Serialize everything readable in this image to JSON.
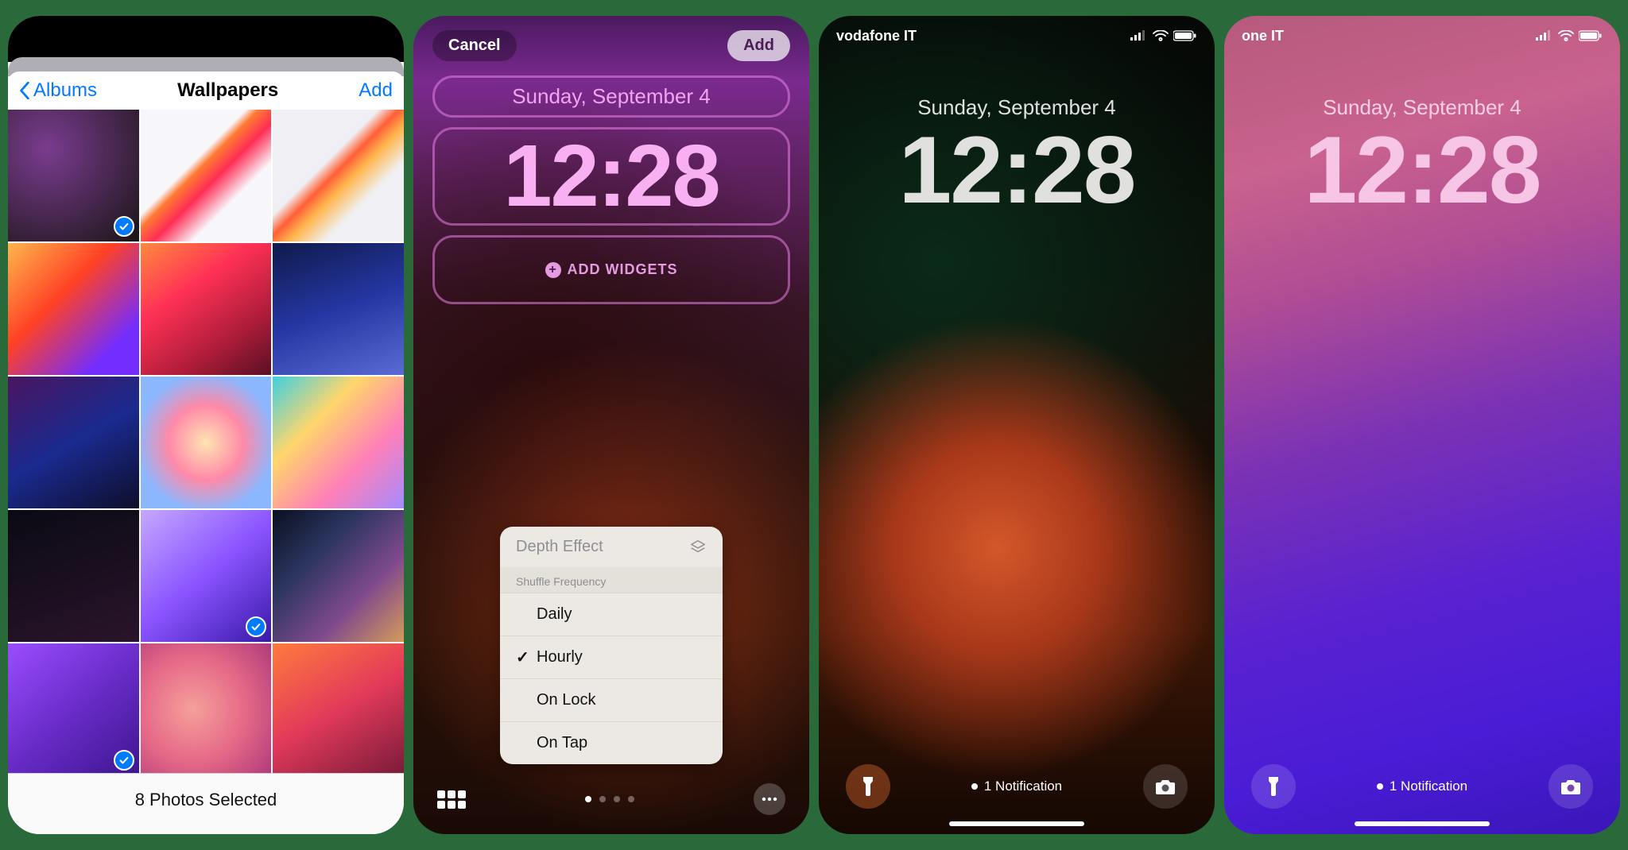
{
  "picker": {
    "back_label": "Albums",
    "title": "Wallpapers",
    "add_label": "Add",
    "selected_footer": "8 Photos Selected",
    "thumbs": [
      {
        "g": "g1",
        "checked": true
      },
      {
        "g": "g2",
        "checked": false
      },
      {
        "g": "g3",
        "checked": false
      },
      {
        "g": "g4",
        "checked": false
      },
      {
        "g": "g5",
        "checked": false
      },
      {
        "g": "g6",
        "checked": false
      },
      {
        "g": "g7",
        "checked": false
      },
      {
        "g": "g8",
        "checked": false
      },
      {
        "g": "g9",
        "checked": false
      },
      {
        "g": "g10",
        "checked": false
      },
      {
        "g": "g11",
        "checked": true
      },
      {
        "g": "g12",
        "checked": false
      },
      {
        "g": "g13",
        "checked": true
      },
      {
        "g": "g14",
        "checked": false
      },
      {
        "g": "g15",
        "checked": false
      }
    ]
  },
  "editor": {
    "cancel": "Cancel",
    "add": "Add",
    "date": "Sunday, September 4",
    "time": "12:28",
    "add_widgets": "ADD WIDGETS",
    "menu": {
      "depth": "Depth Effect",
      "header": "Shuffle Frequency",
      "options": [
        "Daily",
        "Hourly",
        "On Lock",
        "On Tap"
      ],
      "selected": "Hourly"
    }
  },
  "lock3": {
    "carrier": "vodafone IT",
    "date": "Sunday, September 4",
    "time": "12:28",
    "notif": "1 Notification"
  },
  "lock4": {
    "carrier": "one IT",
    "date": "Sunday, September 4",
    "time": "12:28",
    "notif": "1 Notification"
  }
}
